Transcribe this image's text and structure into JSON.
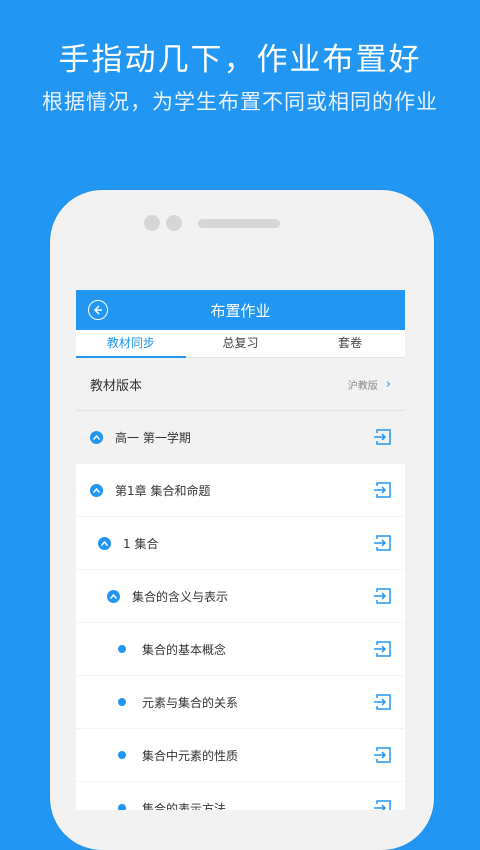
{
  "promo": {
    "headline": "手指动几下，作业布置好",
    "subline": "根据情况，为学生布置不同或相同的作业"
  },
  "colors": {
    "accent": "#2196f3",
    "background": "#2196f3"
  },
  "app": {
    "title": "布置作业",
    "tabs": [
      {
        "label": "教材同步",
        "active": true
      },
      {
        "label": "总复习",
        "active": false
      },
      {
        "label": "套卷",
        "active": false
      }
    ],
    "textbook_version": {
      "label": "教材版本",
      "value": "沪教版"
    },
    "tree": [
      {
        "label": "高一 第一学期",
        "type": "expand",
        "level": 0
      },
      {
        "label": "第1章 集合和命题",
        "type": "expand",
        "level": 1
      },
      {
        "label": "1 集合",
        "type": "expand",
        "level": 2
      },
      {
        "label": "集合的含义与表示",
        "type": "expand",
        "level": 3
      },
      {
        "label": "集合的基本概念",
        "type": "dot",
        "level": 4
      },
      {
        "label": "元素与集合的关系",
        "type": "dot",
        "level": 4
      },
      {
        "label": "集合中元素的性质",
        "type": "dot",
        "level": 4
      },
      {
        "label": "集合的表示方法",
        "type": "dot",
        "level": 4
      }
    ]
  }
}
